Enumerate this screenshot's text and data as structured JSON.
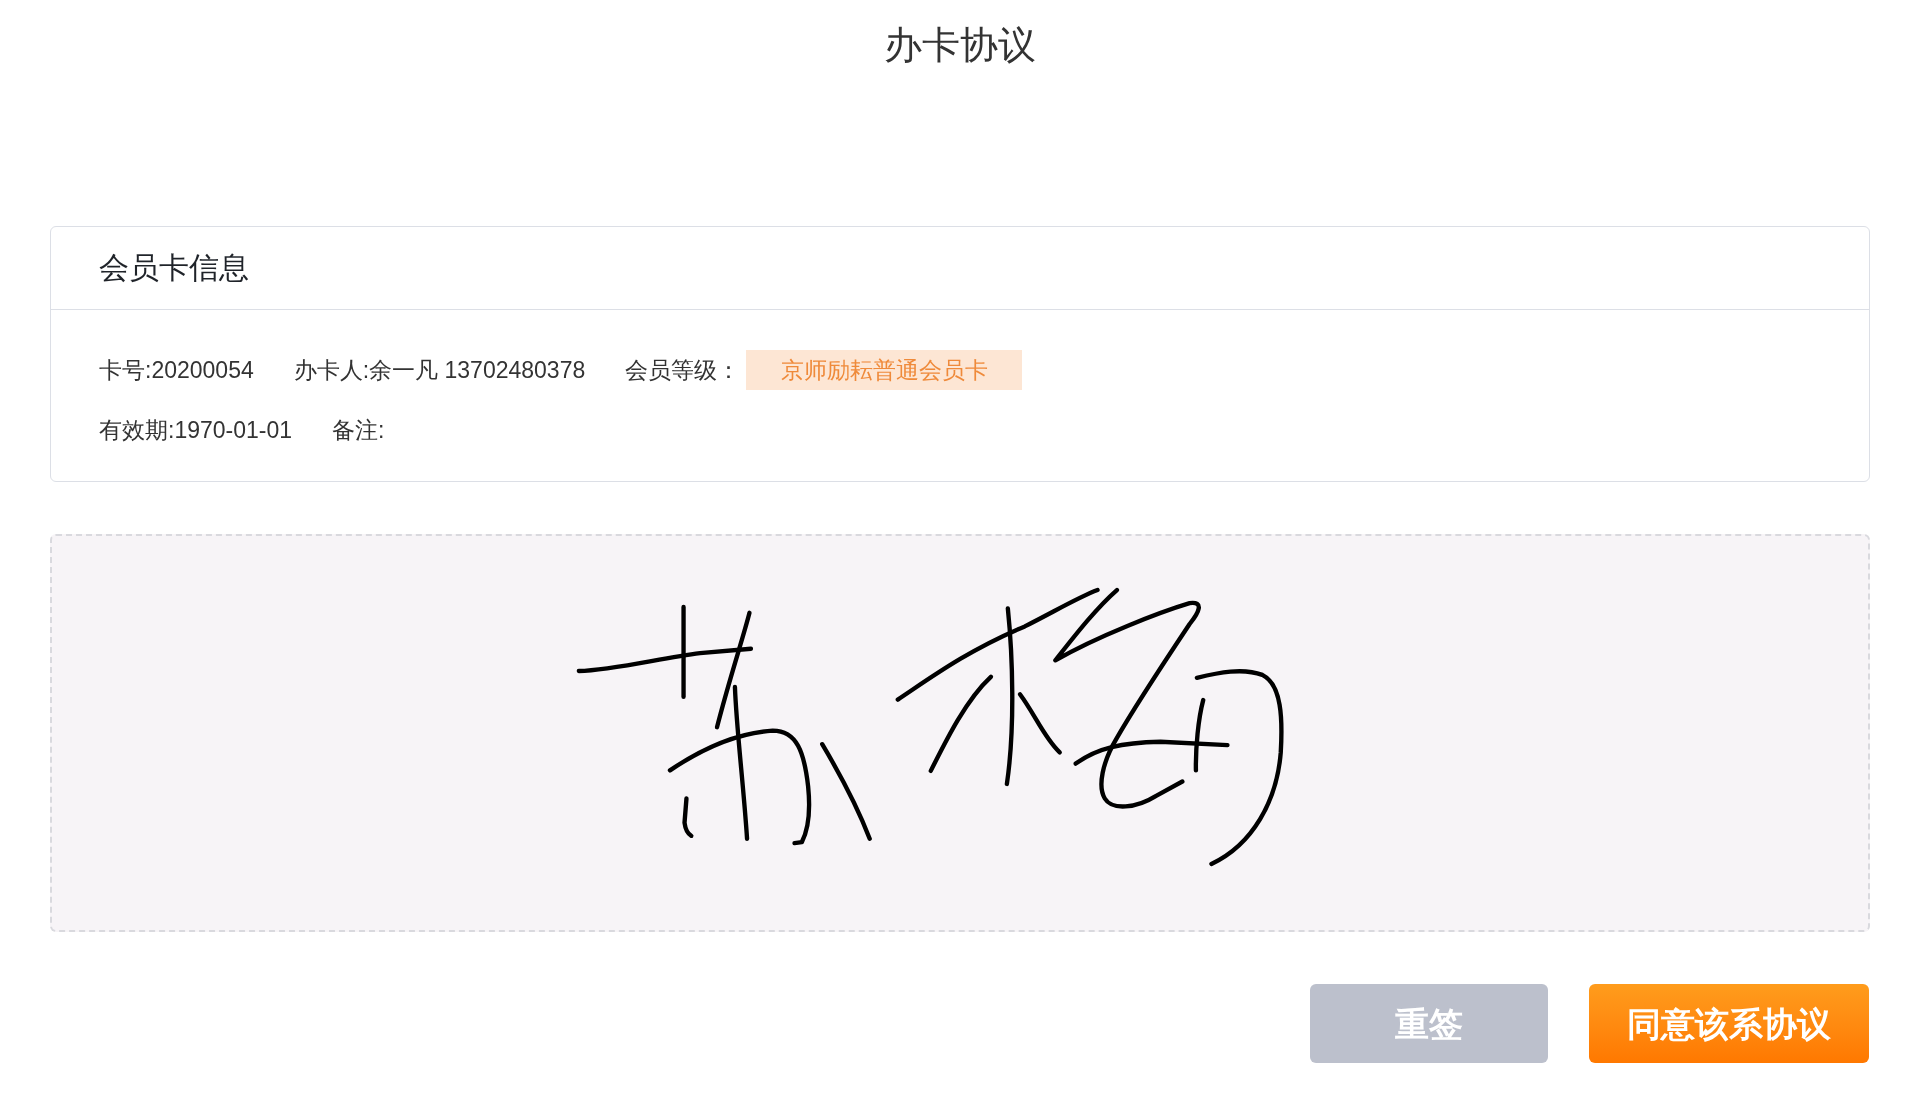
{
  "page": {
    "title": "办卡协议"
  },
  "card_info": {
    "title": "会员卡信息",
    "rows": [
      [
        {
          "kind": "text",
          "text": "卡号:20200054"
        },
        {
          "kind": "text",
          "text": "办卡人:余一凡 13702480378"
        },
        {
          "kind": "label",
          "text": "会员等级："
        },
        {
          "kind": "badge",
          "text": "京师励耘普通会员卡"
        }
      ],
      [
        {
          "kind": "text",
          "text": "有效期:1970-01-01"
        },
        {
          "kind": "text",
          "text": "备注:"
        }
      ]
    ]
  },
  "signature_pad": {
    "signed": true
  },
  "buttons": [
    {
      "kind": "secondary",
      "label": "重签"
    },
    {
      "kind": "primary",
      "label": "同意该系协议"
    }
  ]
}
